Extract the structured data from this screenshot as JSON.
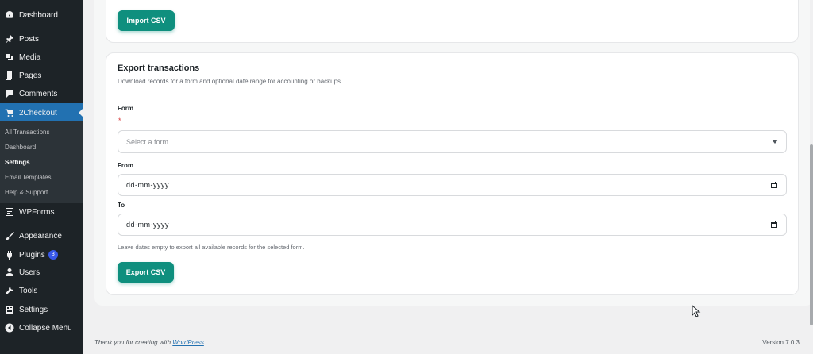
{
  "sidebar": {
    "items": [
      {
        "label": "Dashboard",
        "icon": "dashboard-icon"
      },
      {
        "label": "Posts",
        "icon": "pin-icon"
      },
      {
        "label": "Media",
        "icon": "media-icon"
      },
      {
        "label": "Pages",
        "icon": "pages-icon"
      },
      {
        "label": "Comments",
        "icon": "comment-icon"
      },
      {
        "label": "2Checkout",
        "icon": "cart-icon"
      },
      {
        "label": "WPForms",
        "icon": "form-icon"
      },
      {
        "label": "Appearance",
        "icon": "brush-icon"
      },
      {
        "label": "Plugins",
        "icon": "plugin-icon",
        "badge": "3"
      },
      {
        "label": "Users",
        "icon": "user-icon"
      },
      {
        "label": "Tools",
        "icon": "wrench-icon"
      },
      {
        "label": "Settings",
        "icon": "settings-icon"
      },
      {
        "label": "Collapse Menu",
        "icon": "collapse-icon"
      }
    ],
    "submenu": [
      "All Transactions",
      "Dashboard",
      "Settings",
      "Email Templates",
      "Help & Support"
    ]
  },
  "import": {
    "button_label": "Import CSV"
  },
  "export": {
    "title": "Export transactions",
    "description": "Download records for a form and optional date range for accounting or backups.",
    "form_label": "Form",
    "required_mark": "*",
    "form_placeholder": "Select a form...",
    "from_label": "From",
    "from_value": "dd-mm-yyyy",
    "to_label": "To",
    "to_value": "dd-mm-yyyy",
    "hint": "Leave dates empty to export all available records for the selected form.",
    "button_label": "Export CSV"
  },
  "footer": {
    "thanks_prefix": "Thank you for creating with ",
    "wordpress_link": "WordPress",
    "thanks_suffix": ".",
    "version": "Version 7.0.3"
  },
  "colors": {
    "accent": "#0f8f7e",
    "active_menu": "#2271b1",
    "sidebar_bg": "#1d2327"
  }
}
